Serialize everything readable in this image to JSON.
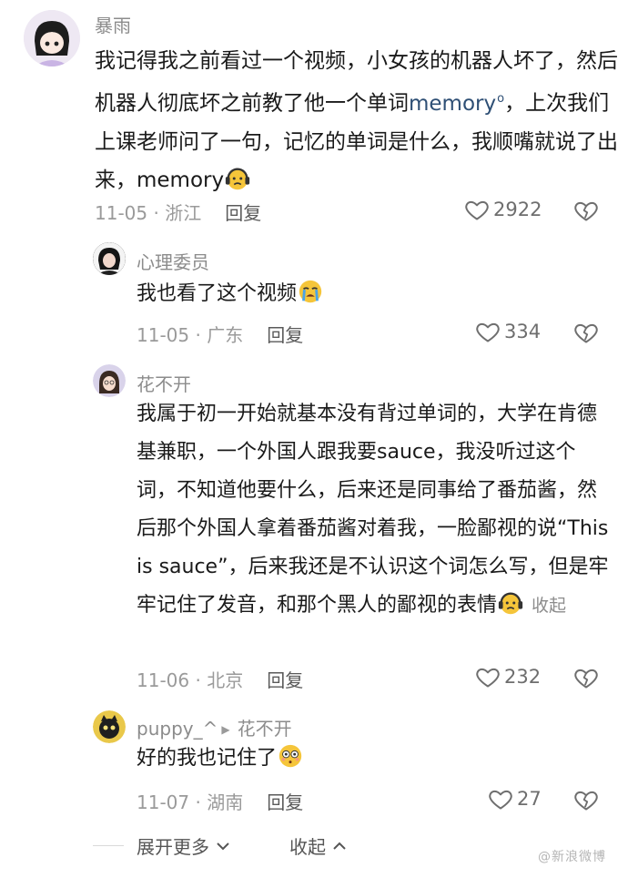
{
  "comments": [
    {
      "username": "暴雨",
      "text_parts": [
        "我记得我之前看过一个视频，小女孩的机器人坏了，然后机器人彻底坏之前教了他一个单词",
        "memory",
        "，上次我们上课老师问了一句，记忆的单词是什么，我顺嘴就说了出来，memory"
      ],
      "date": "11-05",
      "location": "浙江",
      "reply_label": "回复",
      "likes": "2922"
    },
    {
      "username": "心理委员",
      "text": "我也看了这个视频",
      "date": "11-05",
      "location": "广东",
      "reply_label": "回复",
      "likes": "334"
    },
    {
      "username": "花不开",
      "text": "我属于初一开始就基本没有背过单词的，大学在肯德基兼职，一个外国人跟我要sauce，我没听过这个词，不知道他要什么，后来还是同事给了番茄酱，然后那个外国人拿着番茄酱对着我，一脸鄙视的说“This is sauce”，后来我还是不认识这个词怎么写，但是牢牢记住了发音，和那个黑人的鄙视的表情",
      "collapse_label": "收起",
      "date": "11-06",
      "location": "北京",
      "reply_label": "回复",
      "likes": "232"
    },
    {
      "username": "puppy_^",
      "reply_to": "花不开",
      "text": "好的我也记住了",
      "date": "11-07",
      "location": "湖南",
      "reply_label": "回复",
      "likes": "27"
    }
  ],
  "footer": {
    "expand_label": "展开更多",
    "collapse_label": "收起"
  },
  "watermark": "@新浪微博",
  "colors": {
    "text": "#1a1a1a",
    "meta": "#9a9a9a",
    "link": "#2e4f75"
  }
}
